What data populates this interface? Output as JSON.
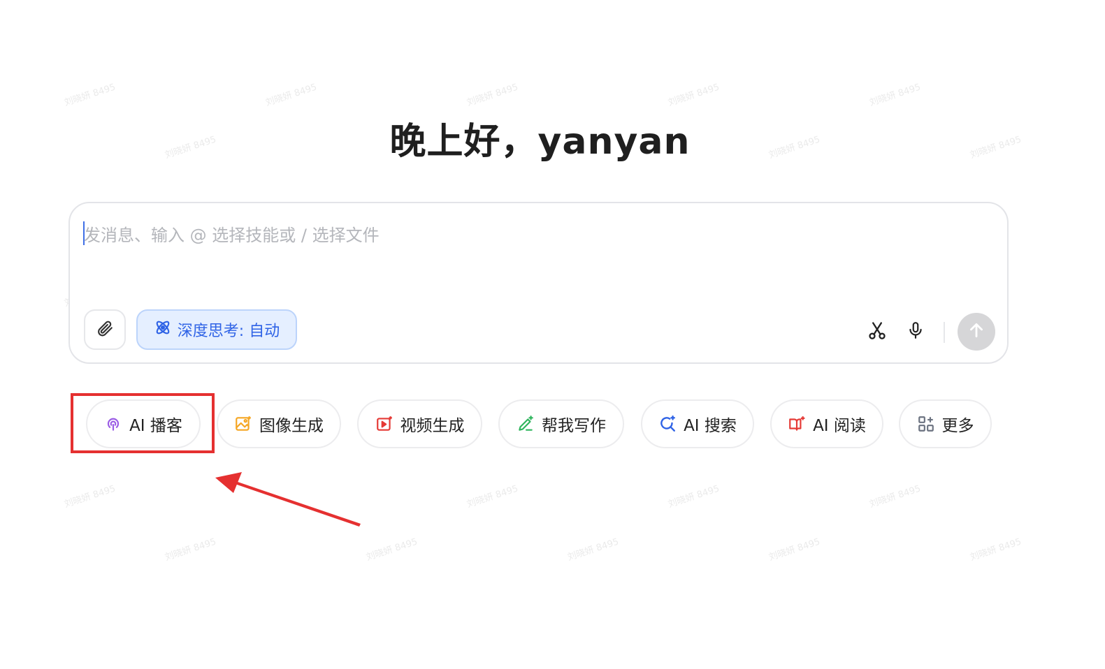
{
  "greeting": "晚上好，yanyan",
  "composer": {
    "placeholder": "发消息、输入 @ 选择技能或 / 选择文件",
    "attach_icon": "paperclip-icon",
    "deep_think_label": "深度思考: 自动",
    "deep_think_icon": "atom-icon",
    "scissors_icon": "scissors-icon",
    "mic_icon": "microphone-icon",
    "send_icon": "arrow-up-icon"
  },
  "quick_actions": [
    {
      "label": "AI 播客",
      "icon": "podcast-icon",
      "color": "#9b5de5"
    },
    {
      "label": "图像生成",
      "icon": "image-icon",
      "color": "#f5a623"
    },
    {
      "label": "视频生成",
      "icon": "video-icon",
      "color": "#e53935"
    },
    {
      "label": "帮我写作",
      "icon": "pen-icon",
      "color": "#2fb55d"
    },
    {
      "label": "AI 搜索",
      "icon": "search-icon",
      "color": "#2f63e6"
    },
    {
      "label": "AI 阅读",
      "icon": "book-icon",
      "color": "#e53935"
    },
    {
      "label": "更多",
      "icon": "grid-icon",
      "color": "#6b7280"
    }
  ],
  "annotation": {
    "highlight_color": "#e53030"
  },
  "watermark_text": "刘晓妍 8495"
}
